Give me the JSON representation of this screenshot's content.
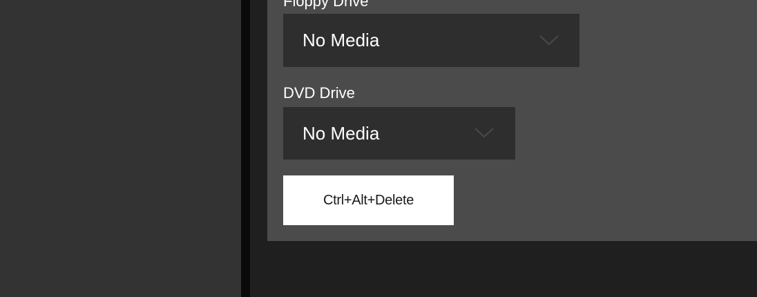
{
  "floppy_drive": {
    "label": "Floppy Drive",
    "selected": "No Media"
  },
  "dvd_drive": {
    "label": "DVD Drive",
    "selected": "No Media"
  },
  "actions": {
    "ctrl_alt_delete_label": "Ctrl+Alt+Delete"
  },
  "icons": {
    "dropdown_arrow": "chevron-down-icon"
  },
  "colors": {
    "panel_bg": "#4b4b4b",
    "dropdown_bg": "#2e2e2e",
    "button_bg": "#ffffff"
  }
}
